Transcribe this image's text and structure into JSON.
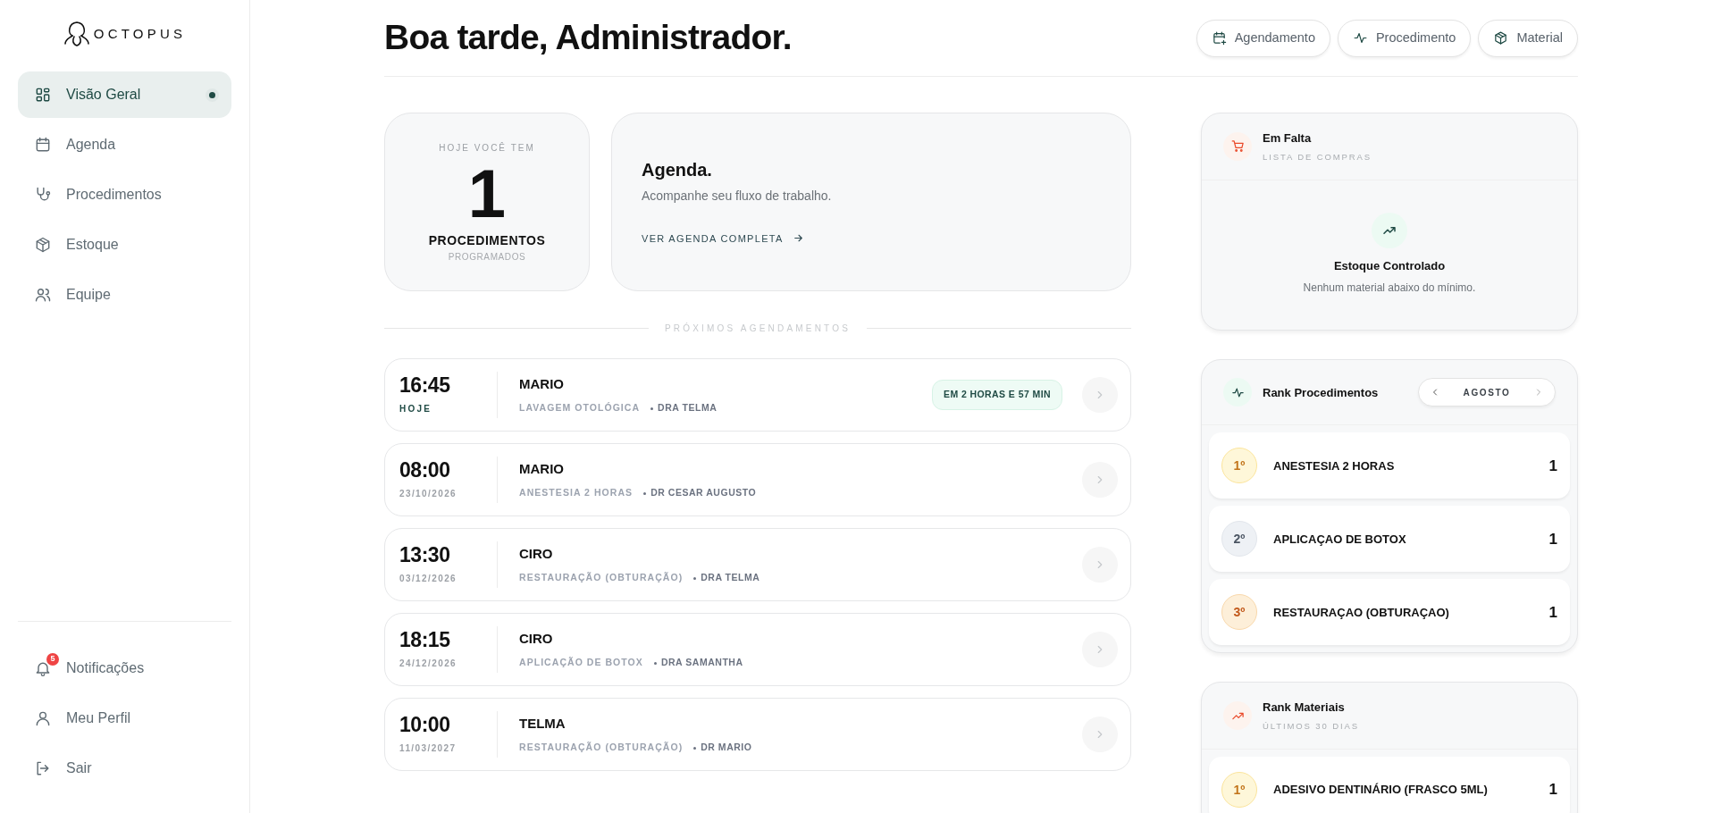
{
  "sidebar": {
    "logo": "OCTOPUS",
    "nav": [
      {
        "label": "Visão Geral",
        "selected": true
      },
      {
        "label": "Agenda",
        "selected": false
      },
      {
        "label": "Procedimentos",
        "selected": false
      },
      {
        "label": "Estoque",
        "selected": false
      },
      {
        "label": "Equipe",
        "selected": false
      }
    ],
    "footer": [
      {
        "label": "Notificações",
        "badge": "5"
      },
      {
        "label": "Meu Perfil"
      },
      {
        "label": "Sair"
      }
    ]
  },
  "header": {
    "greeting": "Boa tarde, Administrador.",
    "actions": [
      "Agendamento",
      "Procedimento",
      "Material"
    ]
  },
  "summary": {
    "eyebrow": "HOJE VOCÊ TEM",
    "count": "1",
    "label": "PROCEDIMENTOS",
    "sublabel": "PROGRAMADOS"
  },
  "agenda_card": {
    "title": "Agenda.",
    "text": "Acompanhe seu fluxo de trabalho.",
    "link": "VER AGENDA COMPLETA"
  },
  "appointments": {
    "heading": "PRÓXIMOS AGENDAMENTOS",
    "items": [
      {
        "time": "16:45",
        "date": "HOJE",
        "today": true,
        "patient": "MARIO",
        "procedure": "LAVAGEM OTOLÓGICA",
        "doctor": "DRA TELMA",
        "countdown": "EM 2 HORAS E 57 MIN"
      },
      {
        "time": "08:00",
        "date": "23/10/2026",
        "today": false,
        "patient": "MARIO",
        "procedure": "ANESTESIA 2 HORAS",
        "doctor": "DR CESAR AUGUSTO"
      },
      {
        "time": "13:30",
        "date": "03/12/2026",
        "today": false,
        "patient": "CIRO",
        "procedure": "RESTAURAÇÃO (OBTURAÇÃO)",
        "doctor": "DRA TELMA"
      },
      {
        "time": "18:15",
        "date": "24/12/2026",
        "today": false,
        "patient": "CIRO",
        "procedure": "APLICAÇÃO DE BOTOX",
        "doctor": "DRA SAMANTHA"
      },
      {
        "time": "10:00",
        "date": "11/03/2027",
        "today": false,
        "patient": "TELMA",
        "procedure": "RESTAURAÇÃO (OBTURAÇÃO)",
        "doctor": "DR MARIO"
      }
    ]
  },
  "shortage": {
    "title": "Em Falta",
    "subtitle": "LISTA DE COMPRAS",
    "empty_title": "Estoque Controlado",
    "empty_text": "Nenhum material abaixo do mínimo."
  },
  "rank_procedures": {
    "title": "Rank Procedimentos",
    "month": "AGOSTO",
    "items": [
      {
        "position": "1º",
        "kind": "gold",
        "name": "ANESTESIA 2 HORAS",
        "count": "1"
      },
      {
        "position": "2º",
        "kind": "silver",
        "name": "APLICAÇAO DE BOTOX",
        "count": "1"
      },
      {
        "position": "3º",
        "kind": "bronze",
        "name": "RESTAURAÇAO (OBTURAÇAO)",
        "count": "1"
      }
    ]
  },
  "rank_materials": {
    "title": "Rank Materiais",
    "subtitle": "ÚLTIMOS 30 DIAS",
    "items": [
      {
        "position": "1º",
        "kind": "gold",
        "name": "ADESIVO DENTINÁRIO (FRASCO 5ML)",
        "count": "1"
      }
    ]
  }
}
